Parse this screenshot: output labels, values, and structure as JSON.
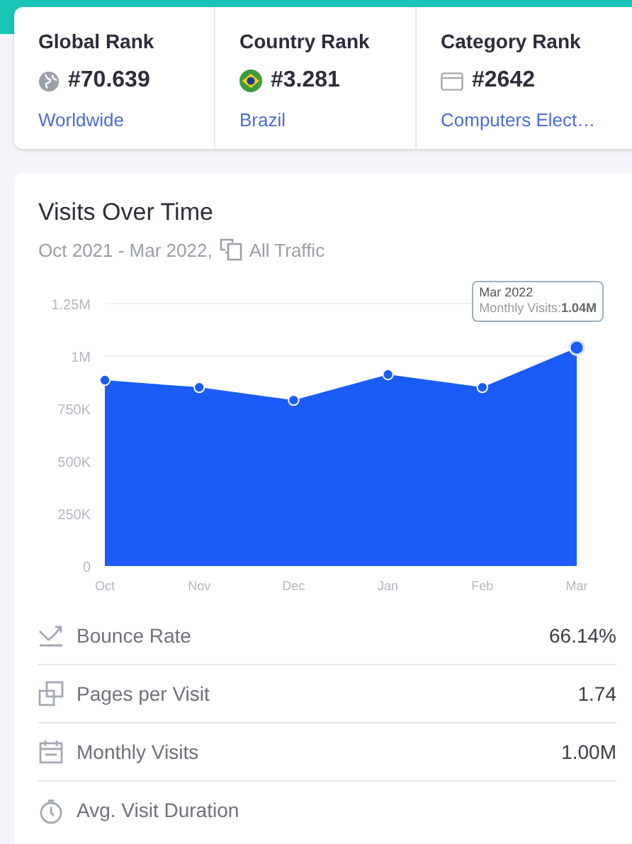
{
  "ranks": [
    {
      "kind": "globe",
      "title": "Global Rank",
      "value": "#70.639",
      "link": "Worldwide"
    },
    {
      "kind": "flag",
      "title": "Country Rank",
      "value": "#3.281",
      "link": "Brazil"
    },
    {
      "kind": "category",
      "title": "Category Rank",
      "value": "#2642",
      "link": "Computers Elect…"
    }
  ],
  "visits": {
    "title": "Visits Over Time",
    "period": "Oct 2021 - Mar 2022,",
    "traffic": "All Traffic",
    "tooltip": {
      "title": "Mar 2022",
      "label": "Monthly Visits:",
      "value": "1.04M"
    },
    "chart_data": {
      "type": "area",
      "categories": [
        "Oct",
        "Nov",
        "Dec",
        "Jan",
        "Feb",
        "Mar"
      ],
      "series": [
        {
          "color": "#1a5cf5",
          "values": [
            885000,
            851000,
            790000,
            912000,
            851000,
            1040000
          ]
        }
      ],
      "ylim": [
        0,
        1250000
      ],
      "yticks": [
        {
          "value": 0,
          "label": "0"
        },
        {
          "value": 250000,
          "label": "250K"
        },
        {
          "value": 500000,
          "label": "500K"
        },
        {
          "value": 750000,
          "label": "750K"
        },
        {
          "value": 1000000,
          "label": "1M"
        },
        {
          "value": 1250000,
          "label": "1.25M"
        }
      ]
    }
  },
  "metrics": [
    {
      "kind": "bounce",
      "label": "Bounce Rate",
      "value": "66.14%"
    },
    {
      "kind": "pages",
      "label": "Pages per Visit",
      "value": "1.74"
    },
    {
      "kind": "calendar",
      "label": "Monthly Visits",
      "value": "1.00M"
    },
    {
      "kind": "timer",
      "label": "Avg. Visit Duration"
    }
  ]
}
